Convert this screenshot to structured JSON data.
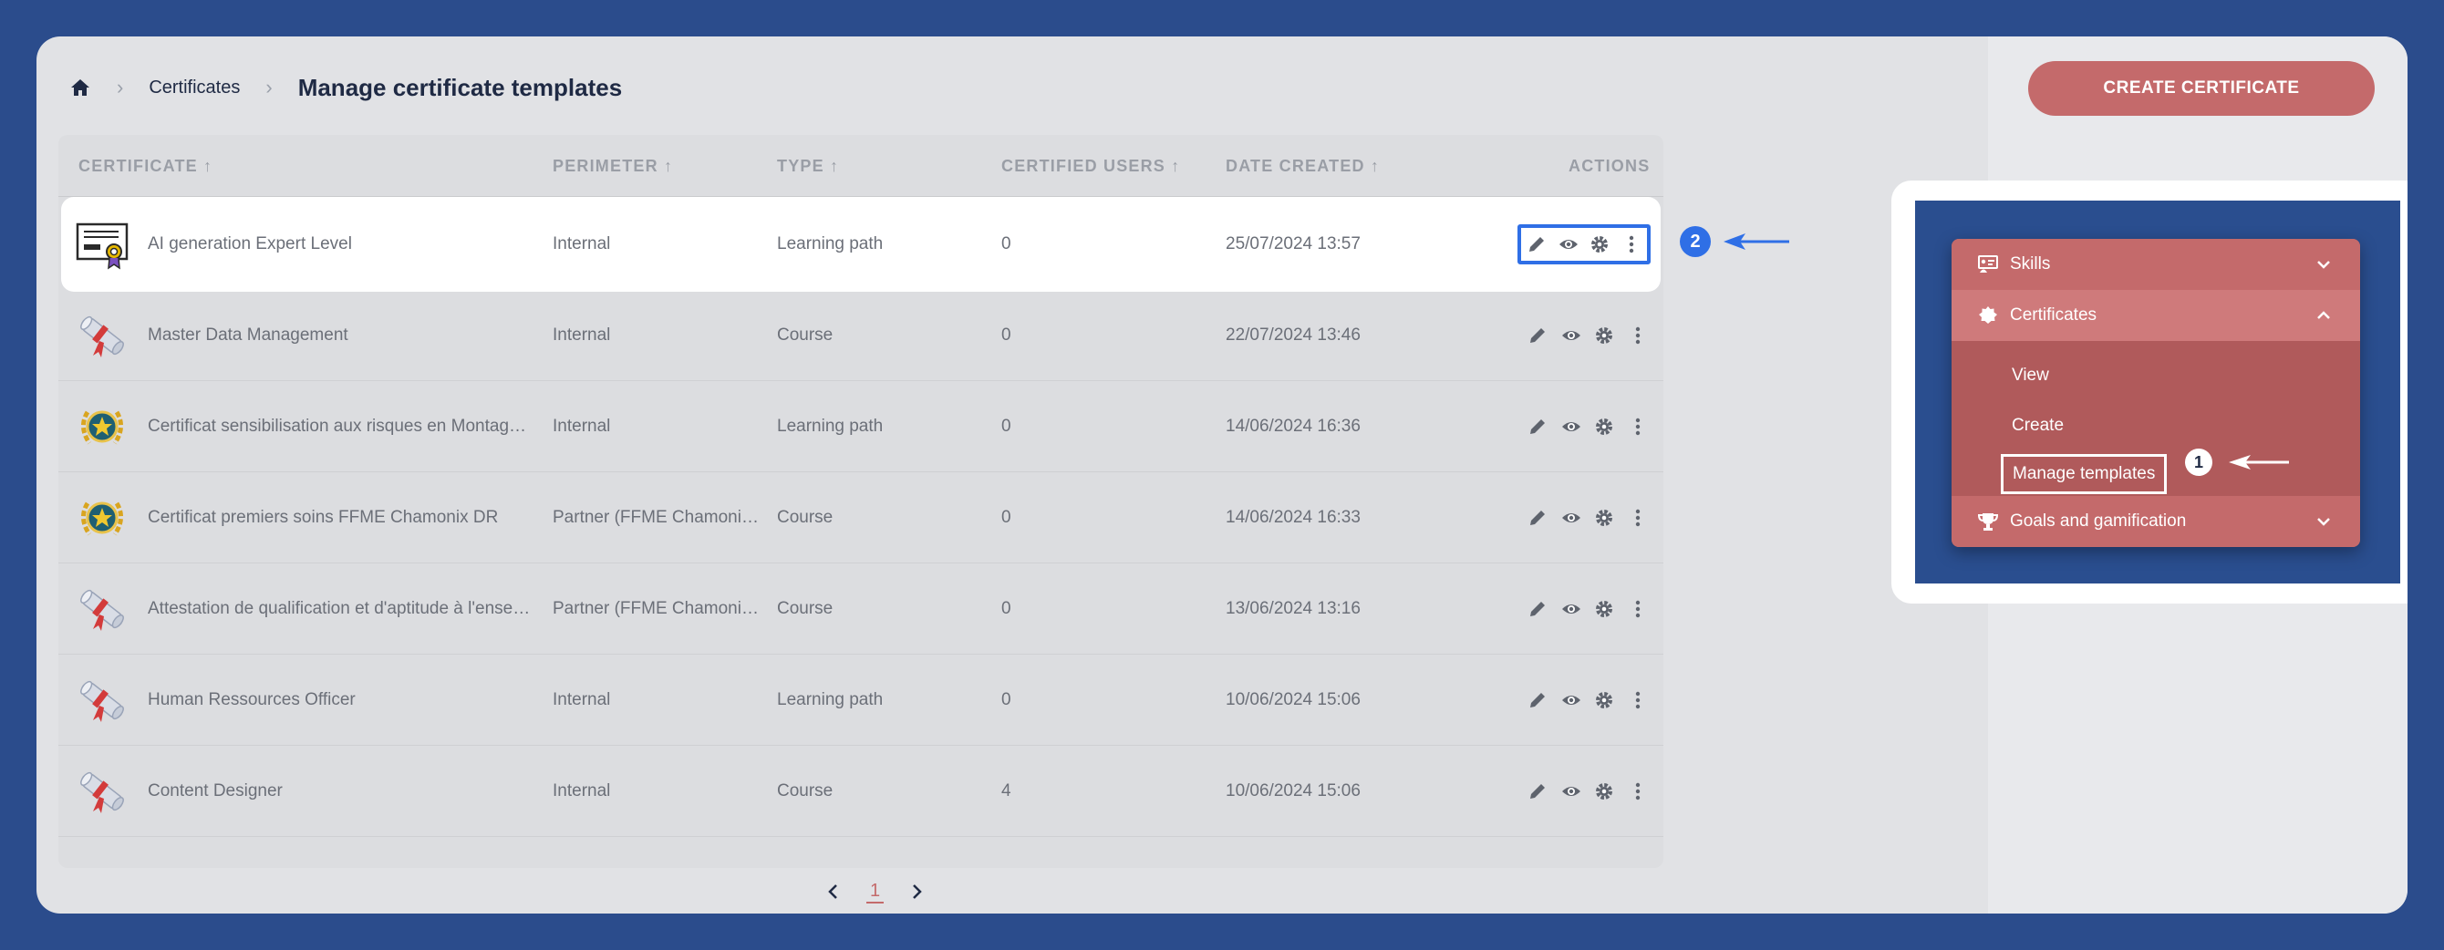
{
  "breadcrumb": {
    "home_icon": "home-icon",
    "link": "Certificates",
    "current": "Manage certificate templates"
  },
  "create_button": "CREATE CERTIFICATE",
  "table": {
    "headers": {
      "certificate": "CERTIFICATE",
      "perimeter": "PERIMETER",
      "type": "TYPE",
      "certified_users": "CERTIFIED USERS",
      "date_created": "DATE CREATED",
      "actions": "ACTIONS"
    },
    "rows": [
      {
        "name": "AI generation Expert Level",
        "perimeter": "Internal",
        "type": "Learning path",
        "users": "0",
        "date": "25/07/2024 13:57",
        "thumb": "certificate-document-icon"
      },
      {
        "name": "Master Data Management",
        "perimeter": "Internal",
        "type": "Course",
        "users": "0",
        "date": "22/07/2024 13:46",
        "thumb": "diploma-scroll-icon"
      },
      {
        "name": "Certificat sensibilisation aux risques en Montagn...",
        "perimeter": "Internal",
        "type": "Learning path",
        "users": "0",
        "date": "14/06/2024 16:36",
        "thumb": "laurel-medal-icon"
      },
      {
        "name": "Certificat premiers soins FFME Chamonix DR",
        "perimeter": "Partner (FFME Chamonix...",
        "type": "Course",
        "users": "0",
        "date": "14/06/2024 16:33",
        "thumb": "laurel-medal-icon"
      },
      {
        "name": "Attestation de qualification et d'aptitude à l'ensei...",
        "perimeter": "Partner (FFME Chamonix...",
        "type": "Course",
        "users": "0",
        "date": "13/06/2024 13:16",
        "thumb": "diploma-scroll-icon"
      },
      {
        "name": "Human Ressources Officer",
        "perimeter": "Internal",
        "type": "Learning path",
        "users": "0",
        "date": "10/06/2024 15:06",
        "thumb": "diploma-scroll-icon"
      },
      {
        "name": "Content Designer",
        "perimeter": "Internal",
        "type": "Course",
        "users": "4",
        "date": "10/06/2024 15:06",
        "thumb": "diploma-scroll-icon"
      }
    ]
  },
  "pagination": {
    "current": "1"
  },
  "annotations": {
    "step1": "1",
    "step2": "2"
  },
  "menu": {
    "skills": "Skills",
    "certificates": "Certificates",
    "view": "View",
    "create": "Create",
    "manage_templates": "Manage templates",
    "goals": "Goals and gamification"
  },
  "colors": {
    "accent": "#c46a6b",
    "highlight_blue": "#2f6fe6",
    "background": "#2b4c8c"
  }
}
